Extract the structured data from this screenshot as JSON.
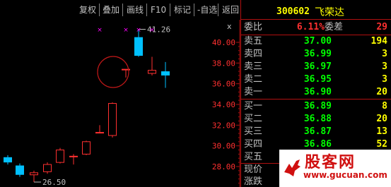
{
  "toolbar": {
    "buttons": [
      "复权",
      "叠加",
      "画线",
      "F10",
      "标记",
      "-自选",
      "返回"
    ],
    "close_glyph": "x"
  },
  "quote": {
    "code": "300602",
    "name": "飞荣达",
    "weibi_label": "委比",
    "weibi_value": "6.11%",
    "weicha_label": "委差",
    "weicha_value": "29",
    "asks": [
      {
        "label": "卖五",
        "price": "37.00",
        "volume": "194"
      },
      {
        "label": "卖四",
        "price": "36.99",
        "volume": "3"
      },
      {
        "label": "卖三",
        "price": "36.97",
        "volume": "3"
      },
      {
        "label": "卖二",
        "price": "36.95",
        "volume": "3"
      },
      {
        "label": "卖一",
        "price": "36.90",
        "volume": "20"
      }
    ],
    "bids": [
      {
        "label": "买一",
        "price": "36.89",
        "volume": "8"
      },
      {
        "label": "买二",
        "price": "36.88",
        "volume": "20"
      },
      {
        "label": "买三",
        "price": "36.87",
        "volume": "13"
      },
      {
        "label": "买四",
        "price": "36.86",
        "volume": "52"
      },
      {
        "label": "买五",
        "price": "",
        "volume": ""
      }
    ],
    "footer_labels": [
      "现价",
      "涨跌"
    ],
    "price_color": "#00ff00",
    "up_color": "#ff3030",
    "volume_color": "#ffff00"
  },
  "chart_data": {
    "type": "candlestick",
    "y_ticks": [
      "40.00",
      "38.00",
      "36.00",
      "34.00",
      "32.00",
      "30.00",
      "28.00"
    ],
    "ylim": [
      27.0,
      42.0
    ],
    "high_label": "41.26",
    "low_label": "26.50",
    "candles": [
      {
        "open": 28.9,
        "close": 28.4,
        "high": 29.1,
        "low": 28.2
      },
      {
        "open": 28.1,
        "close": 27.2,
        "high": 28.3,
        "low": 27.0
      },
      {
        "open": 27.2,
        "close": 27.4,
        "high": 27.6,
        "low": 26.5
      },
      {
        "open": 27.5,
        "close": 28.2,
        "high": 28.4,
        "low": 27.3
      },
      {
        "open": 28.4,
        "close": 29.6,
        "high": 29.8,
        "low": 28.3
      },
      {
        "open": 29.0,
        "close": 29.0,
        "high": 29.2,
        "low": 28.2
      },
      {
        "open": 29.2,
        "close": 30.4,
        "high": 30.5,
        "low": 29.1
      },
      {
        "open": 31.3,
        "close": 31.3,
        "high": 32.0,
        "low": 31.3
      },
      {
        "open": 31.0,
        "close": 34.1,
        "high": 34.2,
        "low": 30.8
      },
      {
        "open": 37.4,
        "close": 37.4,
        "high": 37.4,
        "low": 36.6
      },
      {
        "open": 40.5,
        "close": 38.7,
        "high": 41.26,
        "low": 38.6
      },
      {
        "open": 37.0,
        "close": 37.3,
        "high": 38.6,
        "low": 36.8
      },
      {
        "open": 37.2,
        "close": 36.8,
        "high": 38.1,
        "low": 35.6
      }
    ],
    "up_color": "#ff3030",
    "down_color": "#00c0ff",
    "marker_color": "#ff00ff",
    "annotation": "circle"
  },
  "watermark": {
    "title": "股客网",
    "url": "www.gucuan.com"
  }
}
